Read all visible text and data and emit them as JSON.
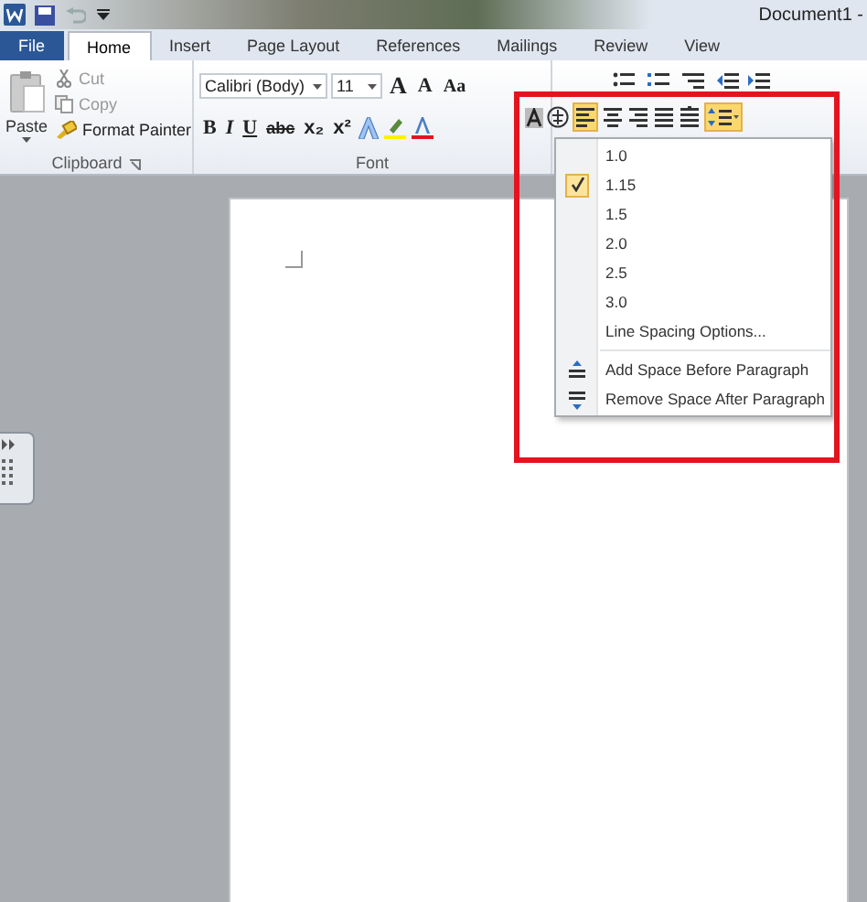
{
  "title_bar": {
    "title": "Document1 -"
  },
  "tabs": [
    {
      "label": "File",
      "kind": "file",
      "selected": false
    },
    {
      "label": "Home",
      "kind": "tab",
      "selected": true
    },
    {
      "label": "Insert",
      "kind": "tab",
      "selected": false
    },
    {
      "label": "Page Layout",
      "kind": "tab",
      "selected": false
    },
    {
      "label": "References",
      "kind": "tab",
      "selected": false
    },
    {
      "label": "Mailings",
      "kind": "tab",
      "selected": false
    },
    {
      "label": "Review",
      "kind": "tab",
      "selected": false
    },
    {
      "label": "View",
      "kind": "tab",
      "selected": false
    }
  ],
  "clipboard": {
    "paste": "Paste",
    "items": [
      {
        "label": "Cut",
        "kind": "cut",
        "disabled": true
      },
      {
        "label": "Copy",
        "kind": "copy",
        "disabled": true
      },
      {
        "label": "Format Painter",
        "kind": "painter",
        "disabled": false
      }
    ],
    "group_label": "Clipboard"
  },
  "font": {
    "font_name": "Calibri (Body)",
    "font_size": "11",
    "grow": "A",
    "shrink": "A",
    "change_case": "Aa",
    "format_buttons": [
      {
        "label": "B",
        "kind": "bold"
      },
      {
        "label": "I",
        "kind": "italic"
      },
      {
        "label": "U",
        "kind": "underline"
      },
      {
        "label": "abc",
        "kind": "strike"
      },
      {
        "label": "x₂",
        "kind": "sub"
      },
      {
        "label": "x²",
        "kind": "sup"
      }
    ],
    "group_label": "Font"
  },
  "paragraph": {
    "align_buttons": [
      {
        "kind": "left",
        "selected": true
      },
      {
        "kind": "center",
        "selected": false
      },
      {
        "kind": "right",
        "selected": false
      },
      {
        "kind": "justify",
        "selected": false
      },
      {
        "kind": "distributed",
        "selected": false
      }
    ],
    "line_spacing_open": true
  },
  "line_spacing_menu": [
    {
      "label": "1.0",
      "kind": "value",
      "checked": false
    },
    {
      "label": "1.15",
      "kind": "value",
      "checked": true
    },
    {
      "label": "1.5",
      "kind": "value",
      "checked": false
    },
    {
      "label": "2.0",
      "kind": "value",
      "checked": false
    },
    {
      "label": "2.5",
      "kind": "value",
      "checked": false
    },
    {
      "label": "3.0",
      "kind": "value",
      "checked": false
    },
    {
      "label": "Line Spacing Options...",
      "kind": "options",
      "checked": false
    },
    {
      "label": "Add Space Before Paragraph",
      "kind": "add_before",
      "checked": false
    },
    {
      "label": "Remove Space After Paragraph",
      "kind": "remove_after",
      "checked": false
    }
  ]
}
